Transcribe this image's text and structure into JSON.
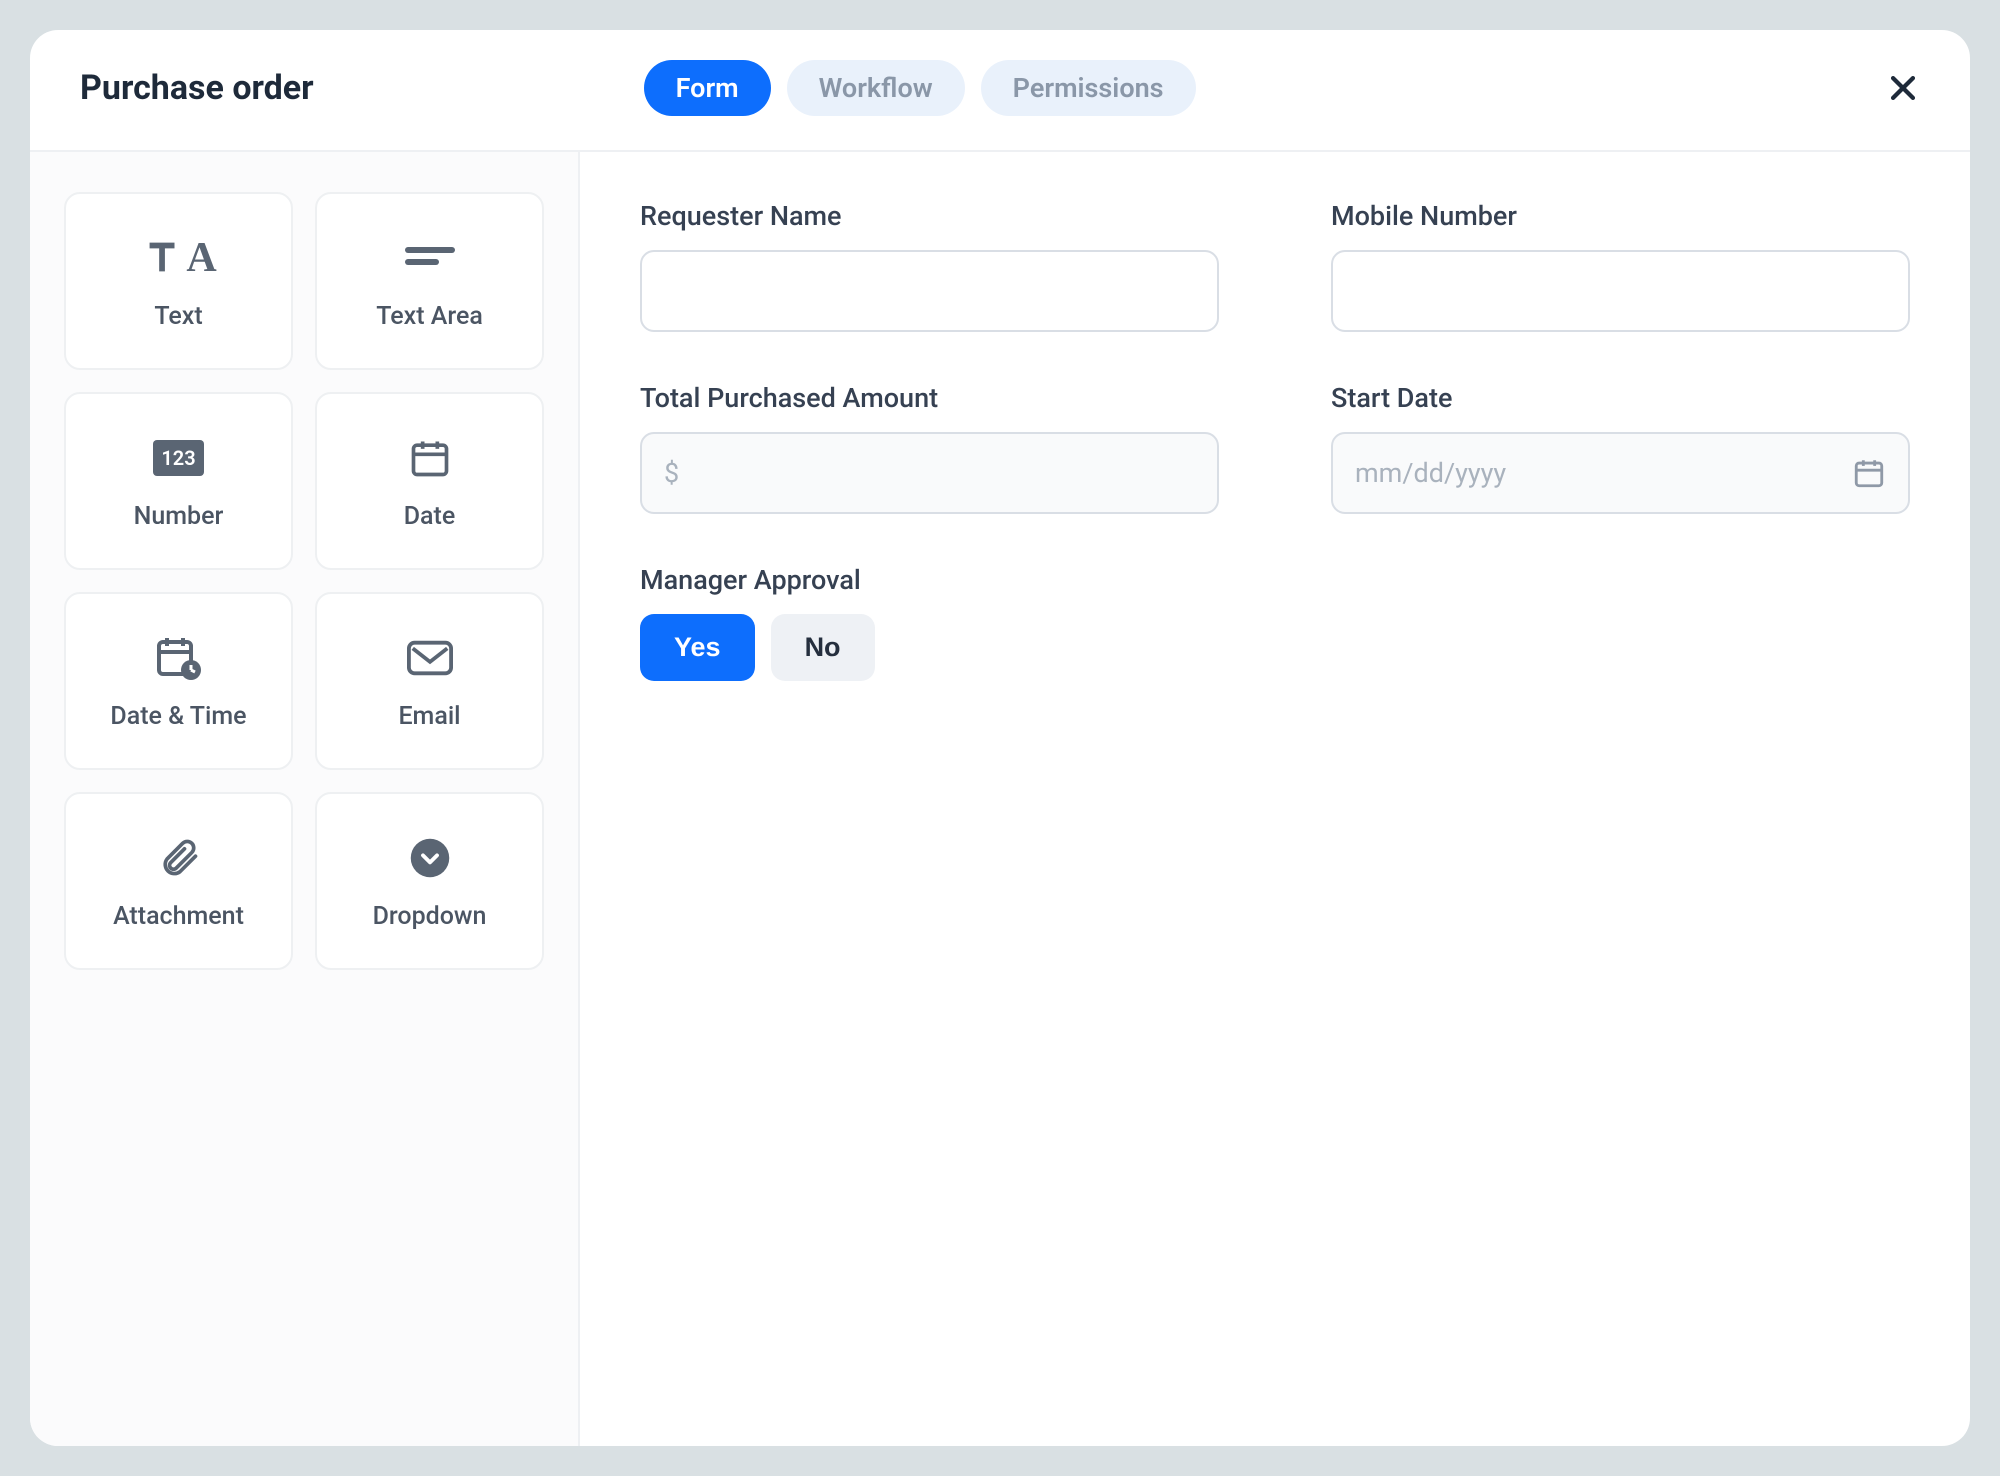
{
  "header": {
    "title": "Purchase order",
    "tabs": [
      {
        "label": "Form",
        "active": true
      },
      {
        "label": "Workflow",
        "active": false
      },
      {
        "label": "Permissions",
        "active": false
      }
    ]
  },
  "sidebar_fields": [
    {
      "label": "Text",
      "icon": "text"
    },
    {
      "label": "Text Area",
      "icon": "textarea"
    },
    {
      "label": "Number",
      "icon": "number"
    },
    {
      "label": "Date",
      "icon": "date"
    },
    {
      "label": "Date & Time",
      "icon": "datetime"
    },
    {
      "label": "Email",
      "icon": "email"
    },
    {
      "label": "Attachment",
      "icon": "attachment"
    },
    {
      "label": "Dropdown",
      "icon": "dropdown"
    }
  ],
  "form": {
    "requester_name": {
      "label": "Requester Name",
      "value": ""
    },
    "mobile_number": {
      "label": "Mobile Number",
      "value": ""
    },
    "total_amount": {
      "label": "Total Purchased Amount",
      "placeholder": "$",
      "value": ""
    },
    "start_date": {
      "label": "Start Date",
      "placeholder": "mm/dd/yyyy",
      "value": ""
    },
    "manager_approval": {
      "label": "Manager Approval",
      "yes": "Yes",
      "no": "No",
      "selected": "Yes"
    }
  }
}
